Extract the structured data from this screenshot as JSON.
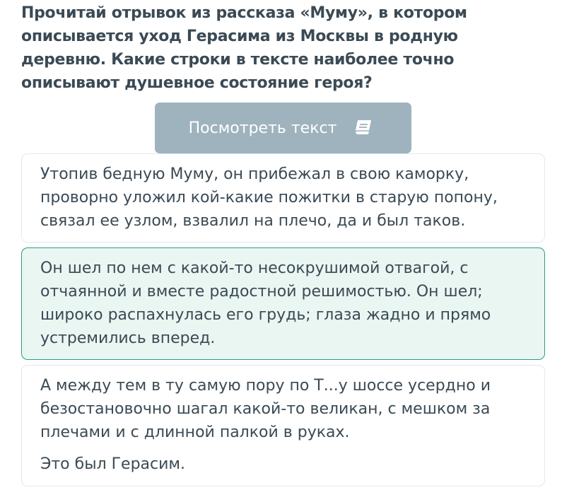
{
  "question": {
    "text": "Прочитай отрывок из рассказа «Муму», в котором описывается уход Герасима из Москвы в родную деревню. Какие строки в тексте наиболее точно описывают душевное состояние героя?"
  },
  "view_text_button": {
    "label": "Посмотреть текст",
    "icon": "book-icon",
    "color": "#9eb3be"
  },
  "answers": [
    {
      "paragraphs": [
        "Утопив бедную Муму, он прибежал в свою каморку, проворно уложил кой-какие пожитки в старую попону, связал ее узлом, взвалил на плечо, да и был таков."
      ],
      "selected": false
    },
    {
      "paragraphs": [
        "Он шел по нем с какой-то несокрушимой отвагой, с отчаянной и вместе радостной решимостью. Он шел; широко распахнулась его грудь; глаза жадно и прямо устремились вперед."
      ],
      "selected": true
    },
    {
      "paragraphs": [
        "А между тем в ту самую пору по Т...у шоссе усердно и безостановочно шагал какой-то великан, с мешком за плечами и с длинной палкой в руках.",
        "Это был Герасим."
      ],
      "selected": false
    }
  ],
  "colors": {
    "text": "#3b4a54",
    "button_bg": "#9eb3be",
    "selected_bg": "#e9f6f2",
    "selected_border": "#2e9b84",
    "card_border": "#e3e8ec"
  }
}
